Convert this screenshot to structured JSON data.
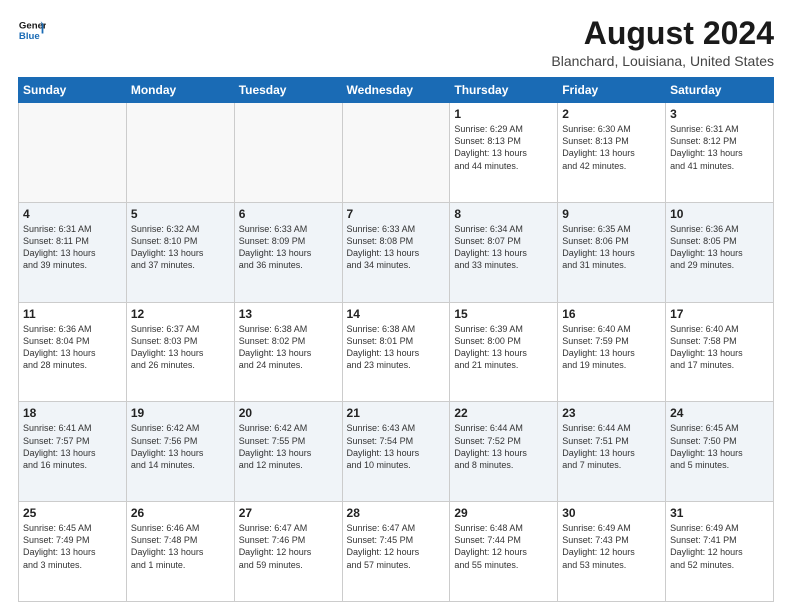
{
  "header": {
    "logo_line1": "General",
    "logo_line2": "Blue",
    "main_title": "August 2024",
    "subtitle": "Blanchard, Louisiana, United States"
  },
  "calendar": {
    "headers": [
      "Sunday",
      "Monday",
      "Tuesday",
      "Wednesday",
      "Thursday",
      "Friday",
      "Saturday"
    ],
    "weeks": [
      [
        {
          "day": "",
          "info": ""
        },
        {
          "day": "",
          "info": ""
        },
        {
          "day": "",
          "info": ""
        },
        {
          "day": "",
          "info": ""
        },
        {
          "day": "1",
          "info": "Sunrise: 6:29 AM\nSunset: 8:13 PM\nDaylight: 13 hours\nand 44 minutes."
        },
        {
          "day": "2",
          "info": "Sunrise: 6:30 AM\nSunset: 8:13 PM\nDaylight: 13 hours\nand 42 minutes."
        },
        {
          "day": "3",
          "info": "Sunrise: 6:31 AM\nSunset: 8:12 PM\nDaylight: 13 hours\nand 41 minutes."
        }
      ],
      [
        {
          "day": "4",
          "info": "Sunrise: 6:31 AM\nSunset: 8:11 PM\nDaylight: 13 hours\nand 39 minutes."
        },
        {
          "day": "5",
          "info": "Sunrise: 6:32 AM\nSunset: 8:10 PM\nDaylight: 13 hours\nand 37 minutes."
        },
        {
          "day": "6",
          "info": "Sunrise: 6:33 AM\nSunset: 8:09 PM\nDaylight: 13 hours\nand 36 minutes."
        },
        {
          "day": "7",
          "info": "Sunrise: 6:33 AM\nSunset: 8:08 PM\nDaylight: 13 hours\nand 34 minutes."
        },
        {
          "day": "8",
          "info": "Sunrise: 6:34 AM\nSunset: 8:07 PM\nDaylight: 13 hours\nand 33 minutes."
        },
        {
          "day": "9",
          "info": "Sunrise: 6:35 AM\nSunset: 8:06 PM\nDaylight: 13 hours\nand 31 minutes."
        },
        {
          "day": "10",
          "info": "Sunrise: 6:36 AM\nSunset: 8:05 PM\nDaylight: 13 hours\nand 29 minutes."
        }
      ],
      [
        {
          "day": "11",
          "info": "Sunrise: 6:36 AM\nSunset: 8:04 PM\nDaylight: 13 hours\nand 28 minutes."
        },
        {
          "day": "12",
          "info": "Sunrise: 6:37 AM\nSunset: 8:03 PM\nDaylight: 13 hours\nand 26 minutes."
        },
        {
          "day": "13",
          "info": "Sunrise: 6:38 AM\nSunset: 8:02 PM\nDaylight: 13 hours\nand 24 minutes."
        },
        {
          "day": "14",
          "info": "Sunrise: 6:38 AM\nSunset: 8:01 PM\nDaylight: 13 hours\nand 23 minutes."
        },
        {
          "day": "15",
          "info": "Sunrise: 6:39 AM\nSunset: 8:00 PM\nDaylight: 13 hours\nand 21 minutes."
        },
        {
          "day": "16",
          "info": "Sunrise: 6:40 AM\nSunset: 7:59 PM\nDaylight: 13 hours\nand 19 minutes."
        },
        {
          "day": "17",
          "info": "Sunrise: 6:40 AM\nSunset: 7:58 PM\nDaylight: 13 hours\nand 17 minutes."
        }
      ],
      [
        {
          "day": "18",
          "info": "Sunrise: 6:41 AM\nSunset: 7:57 PM\nDaylight: 13 hours\nand 16 minutes."
        },
        {
          "day": "19",
          "info": "Sunrise: 6:42 AM\nSunset: 7:56 PM\nDaylight: 13 hours\nand 14 minutes."
        },
        {
          "day": "20",
          "info": "Sunrise: 6:42 AM\nSunset: 7:55 PM\nDaylight: 13 hours\nand 12 minutes."
        },
        {
          "day": "21",
          "info": "Sunrise: 6:43 AM\nSunset: 7:54 PM\nDaylight: 13 hours\nand 10 minutes."
        },
        {
          "day": "22",
          "info": "Sunrise: 6:44 AM\nSunset: 7:52 PM\nDaylight: 13 hours\nand 8 minutes."
        },
        {
          "day": "23",
          "info": "Sunrise: 6:44 AM\nSunset: 7:51 PM\nDaylight: 13 hours\nand 7 minutes."
        },
        {
          "day": "24",
          "info": "Sunrise: 6:45 AM\nSunset: 7:50 PM\nDaylight: 13 hours\nand 5 minutes."
        }
      ],
      [
        {
          "day": "25",
          "info": "Sunrise: 6:45 AM\nSunset: 7:49 PM\nDaylight: 13 hours\nand 3 minutes."
        },
        {
          "day": "26",
          "info": "Sunrise: 6:46 AM\nSunset: 7:48 PM\nDaylight: 13 hours\nand 1 minute."
        },
        {
          "day": "27",
          "info": "Sunrise: 6:47 AM\nSunset: 7:46 PM\nDaylight: 12 hours\nand 59 minutes."
        },
        {
          "day": "28",
          "info": "Sunrise: 6:47 AM\nSunset: 7:45 PM\nDaylight: 12 hours\nand 57 minutes."
        },
        {
          "day": "29",
          "info": "Sunrise: 6:48 AM\nSunset: 7:44 PM\nDaylight: 12 hours\nand 55 minutes."
        },
        {
          "day": "30",
          "info": "Sunrise: 6:49 AM\nSunset: 7:43 PM\nDaylight: 12 hours\nand 53 minutes."
        },
        {
          "day": "31",
          "info": "Sunrise: 6:49 AM\nSunset: 7:41 PM\nDaylight: 12 hours\nand 52 minutes."
        }
      ]
    ]
  }
}
